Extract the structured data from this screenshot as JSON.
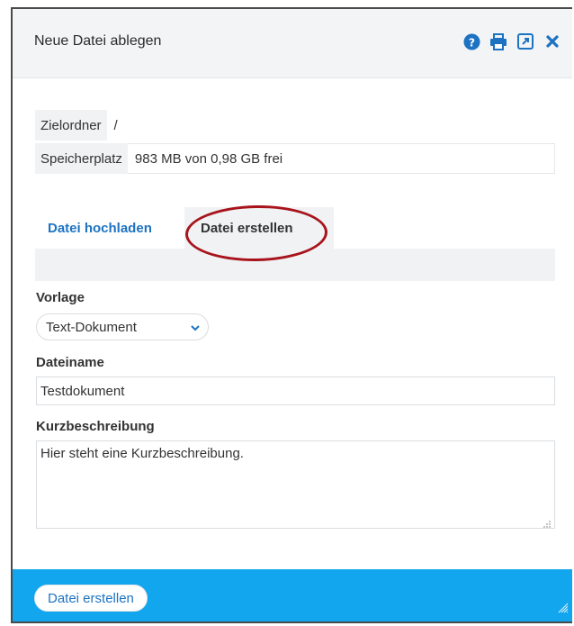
{
  "dialog": {
    "title": "Neue Datei ablegen",
    "tools": [
      {
        "icon": "help-icon",
        "color": "#1d73c2"
      },
      {
        "icon": "print-icon",
        "color": "#1d73c2"
      },
      {
        "icon": "external-link-icon",
        "color": "#1d73c2"
      },
      {
        "icon": "close-icon",
        "color": "#1d73c2"
      }
    ]
  },
  "info": {
    "rows": [
      {
        "label": "Zielordner",
        "value": "/"
      },
      {
        "label": "Speicherplatz",
        "value": "983 MB von 0,98 GB frei"
      }
    ]
  },
  "tabs": [
    {
      "label": "Datei hochladen",
      "active": false
    },
    {
      "label": "Datei erstellen",
      "active": true
    }
  ],
  "form": {
    "template_label": "Vorlage",
    "template_value": "Text-Dokument",
    "filename_label": "Dateiname",
    "filename_value": "Testdokument",
    "description_label": "Kurzbeschreibung",
    "description_value": "Hier steht eine Kurzbeschreibung."
  },
  "footer": {
    "submit_label": "Datei erstellen",
    "background": "#12a6ee"
  },
  "colors": {
    "accent": "#1d73c2",
    "annotation": "#a8141b"
  }
}
